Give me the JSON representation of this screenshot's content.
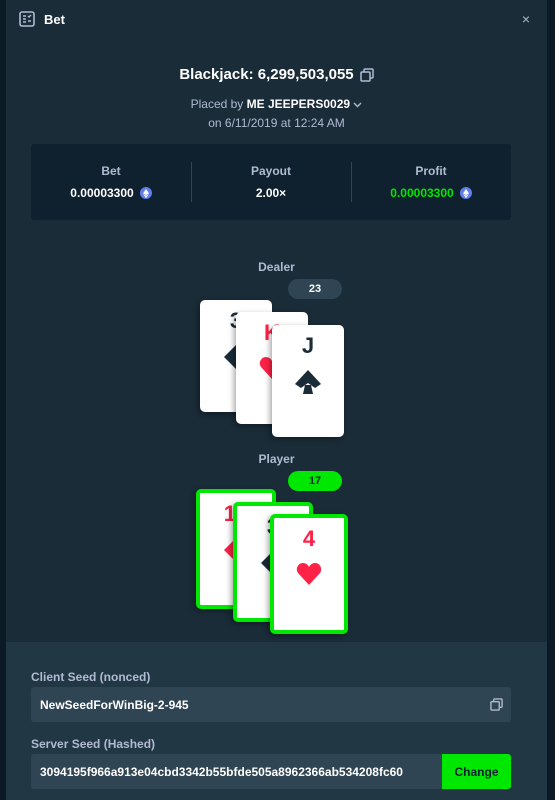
{
  "modal": {
    "header_title": "Bet",
    "close_glyph": "×",
    "header_icon": "bet-slip-icon"
  },
  "bet": {
    "game_title": "Blackjack: 6,299,503,055",
    "placed_by_prefix": "Placed by",
    "username": "ME JEEPERS0029",
    "placed_on": "on 6/11/2019 at 12:24 AM"
  },
  "stats": {
    "bet_label": "Bet",
    "bet_value": "0.00003300",
    "payout_label": "Payout",
    "payout_value": "2.00×",
    "profit_label": "Profit",
    "profit_value": "0.00003300",
    "currency_icon": "eth-coin-icon"
  },
  "dealer": {
    "label": "Dealer",
    "score": "23",
    "cards": [
      {
        "rank": "3",
        "suit": "diamond",
        "color": "black"
      },
      {
        "rank": "K",
        "suit": "heart",
        "color": "red"
      },
      {
        "rank": "J",
        "suit": "spade",
        "color": "black"
      }
    ]
  },
  "player": {
    "label": "Player",
    "score": "17",
    "cards": [
      {
        "rank": "10",
        "suit": "diamond",
        "color": "red"
      },
      {
        "rank": "3",
        "suit": "diamond",
        "color": "black"
      },
      {
        "rank": "4",
        "suit": "heart",
        "color": "red"
      }
    ]
  },
  "seeds": {
    "client_label": "Client Seed (nonced)",
    "client_value": "NewSeedForWinBig-2-945",
    "server_label": "Server Seed (Hashed)",
    "server_value": "3094195f966a913e04cbd3342b55bfde505a8962366ab534208fc60",
    "change_label": "Change"
  },
  "colors": {
    "accent_green": "#00e701",
    "loss_red": "#fe2247",
    "panel": "#1a2c38"
  }
}
